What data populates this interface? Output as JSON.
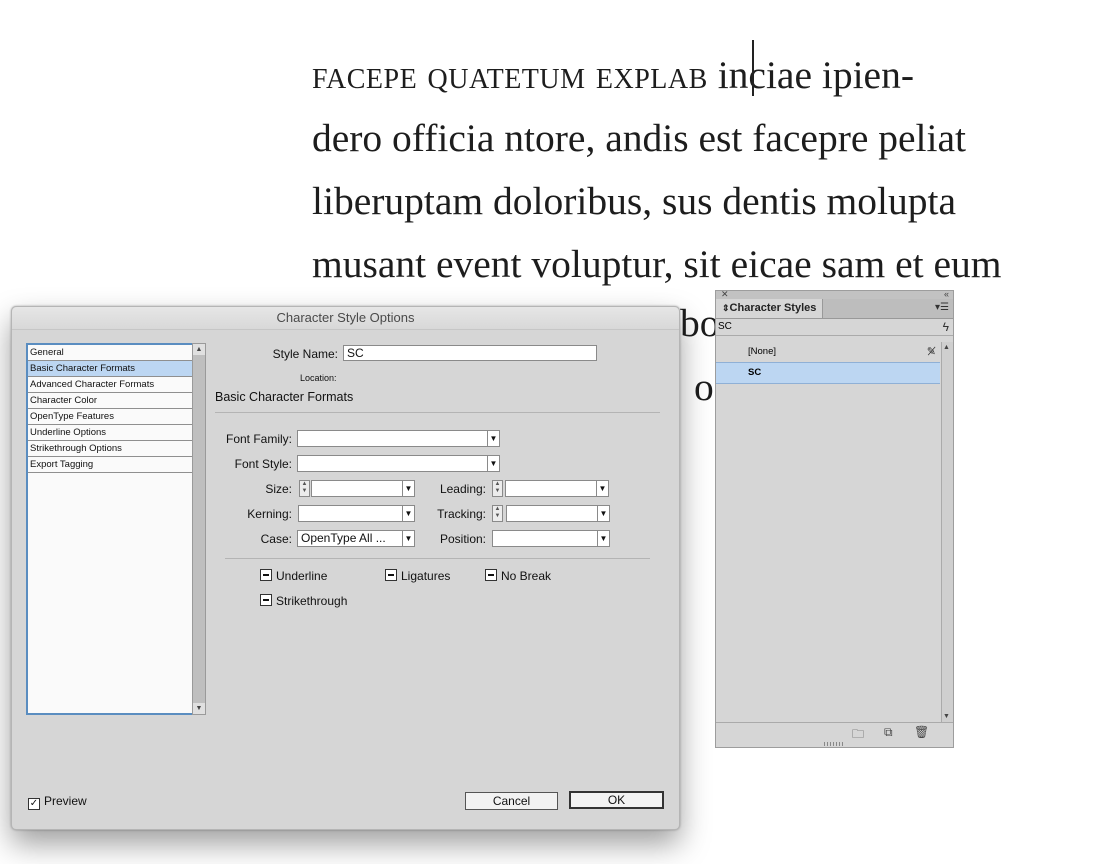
{
  "document": {
    "lines": [
      {
        "sc": "facepe quatetum explab",
        "rest": " inciae ipien-"
      },
      {
        "text": "dero officia ntore, andis est facepre peliat"
      },
      {
        "text": "liberuptam doloribus, sus dentis molupta"
      },
      {
        "text": "musant event voluptur, sit eicae sam et eum"
      }
    ],
    "partial_1": "bo",
    "partial_2": "o"
  },
  "dialog": {
    "title": "Character Style Options",
    "sidebar": [
      {
        "label": "General"
      },
      {
        "label": "Basic Character Formats",
        "selected": true
      },
      {
        "label": "Advanced Character Formats"
      },
      {
        "label": "Character Color"
      },
      {
        "label": "OpenType Features"
      },
      {
        "label": "Underline Options"
      },
      {
        "label": "Strikethrough Options"
      },
      {
        "label": "Export Tagging"
      }
    ],
    "style_name_label": "Style Name:",
    "style_name_value": "SC",
    "location_label": "Location:",
    "section_title": "Basic Character Formats",
    "font_family_label": "Font Family:",
    "font_family_value": "",
    "font_style_label": "Font Style:",
    "font_style_value": "",
    "size_label": "Size:",
    "size_value": "",
    "leading_label": "Leading:",
    "leading_value": "",
    "kerning_label": "Kerning:",
    "kerning_value": "",
    "tracking_label": "Tracking:",
    "tracking_value": "",
    "case_label": "Case:",
    "case_value": "OpenType All ...",
    "position_label": "Position:",
    "position_value": "",
    "checkboxes": {
      "underline": "Underline",
      "ligatures": "Ligatures",
      "no_break": "No Break",
      "strikethrough": "Strikethrough"
    },
    "preview_label": "Preview",
    "preview_checked": true,
    "cancel_label": "Cancel",
    "ok_label": "OK"
  },
  "panel": {
    "title": "Character Styles",
    "current_style": "SC",
    "rows": [
      {
        "label": "[None]"
      },
      {
        "label": "SC",
        "selected": true
      }
    ],
    "icons": [
      "close-icon",
      "collapse-icon",
      "panel-menu-icon",
      "lightning-icon",
      "new-folder-icon",
      "new-style-icon",
      "trash-icon"
    ]
  },
  "colors": {
    "dialog_bg": "#d6d6d6",
    "selection": "#bcd6f2",
    "list_border": "#5a8dc0"
  }
}
